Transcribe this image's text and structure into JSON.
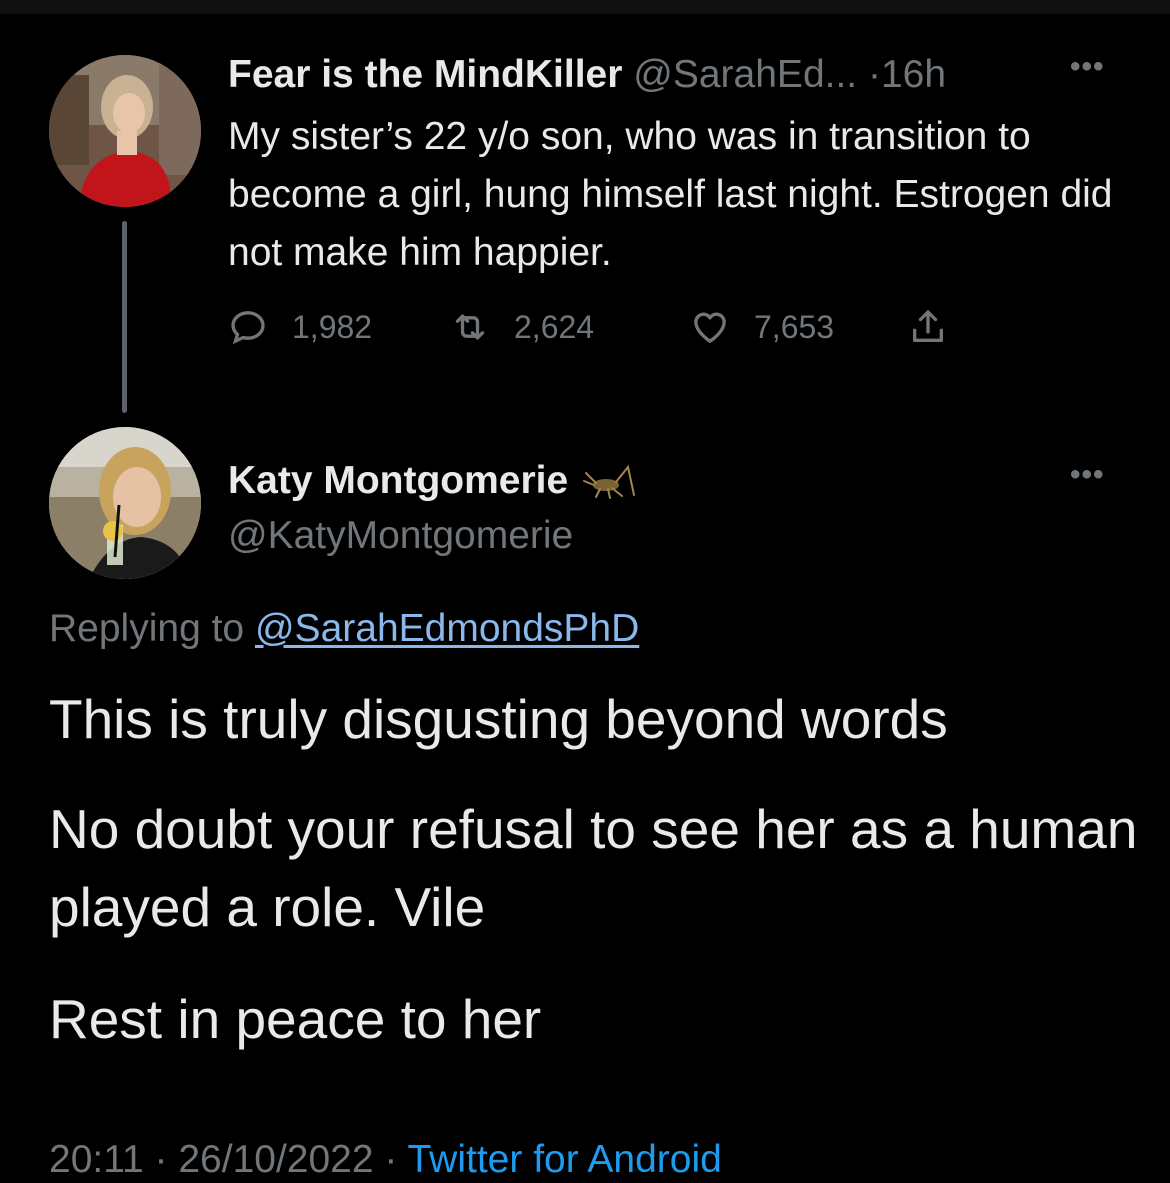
{
  "original_tweet": {
    "display_name": "Fear is the MindKiller",
    "handle": "@SarahEd...",
    "separator": "·",
    "time": "16h",
    "text": "My sister’s 22 y/o son, who was in transition to become a girl, hung himself last night. Estrogen did not make him happier.",
    "more_label": "•••",
    "replies": "1,982",
    "retweets": "2,624",
    "likes": "7,653"
  },
  "reply_tweet": {
    "display_name": "Katy Montgomerie",
    "handle": "@KatyMontgomerie",
    "more_label": "•••",
    "replying_label": "Replying to",
    "replying_to": "@SarahEdmondsPhD",
    "paragraphs": [
      "This is truly disgusting beyond words",
      "No doubt your refusal to see her as a human played a role. Vile",
      "Rest in peace to her"
    ],
    "footer_time": "20:11 · 26/10/2022 ·",
    "footer_source": "Twitter for Android"
  },
  "icons": {
    "reply": "reply-icon",
    "retweet": "retweet-icon",
    "like": "heart-icon",
    "share": "share-icon",
    "badge": "cricket-icon"
  },
  "colors": {
    "background": "#000000",
    "primary_text": "#e7e9ea",
    "secondary_text": "#71767b",
    "link": "#8ab8ea",
    "accent": "#1d9bf0",
    "thread_line": "#5c6268"
  }
}
